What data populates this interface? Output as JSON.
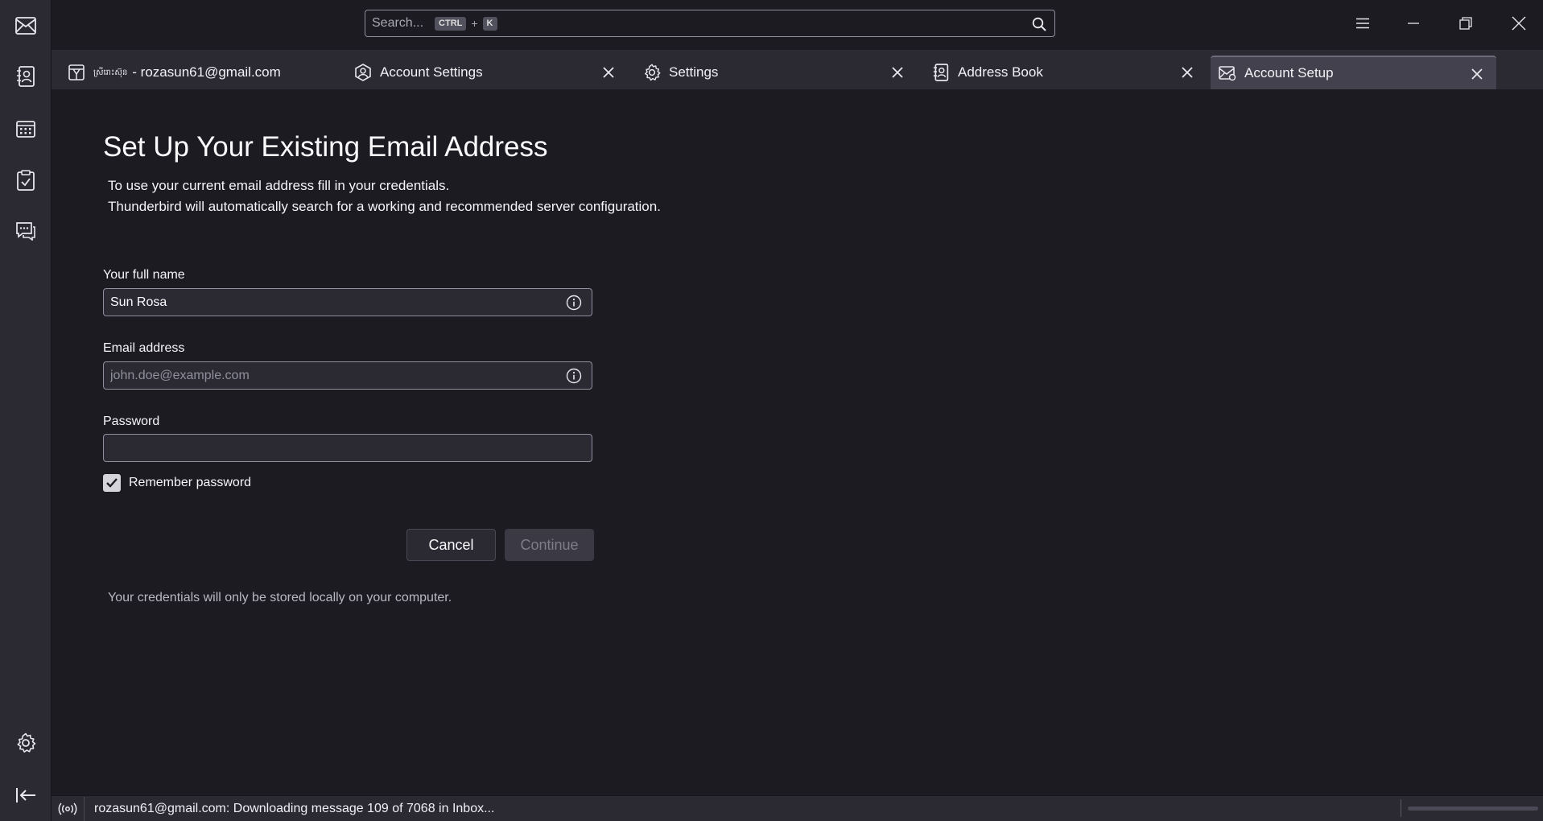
{
  "search": {
    "placeholder": "Search...",
    "shortcut_key1": "CTRL",
    "shortcut_plus": "+",
    "shortcut_key2": "K"
  },
  "tabs": [
    {
      "label": "- rozasun61@gmail.com",
      "prefix": "ស្រីរោះស៊ុន",
      "icon": "inbox-icon",
      "closable": false
    },
    {
      "label": "Account Settings",
      "icon": "account-settings-icon",
      "closable": true
    },
    {
      "label": "Settings",
      "icon": "gear-icon",
      "closable": true
    },
    {
      "label": "Address Book",
      "icon": "address-book-icon",
      "closable": true
    },
    {
      "label": "Account Setup",
      "icon": "account-setup-icon",
      "closable": true,
      "active": true
    }
  ],
  "spaces": [
    "mail-icon",
    "address-book-icon",
    "calendar-icon",
    "tasks-icon",
    "chat-icon",
    "settings-icon",
    "collapse-icon"
  ],
  "main": {
    "title": "Set Up Your Existing Email Address",
    "intro_line1": "To use your current email address fill in your credentials.",
    "intro_line2": "Thunderbird will automatically search for a working and recommended server configuration.",
    "name_label": "Your full name",
    "name_value": "Sun Rosa",
    "email_label": "Email address",
    "email_placeholder": "john.doe@example.com",
    "email_value": "",
    "password_label": "Password",
    "password_value": "",
    "remember_label": "Remember password",
    "remember_checked": true,
    "cancel_label": "Cancel",
    "continue_label": "Continue",
    "continue_enabled": false,
    "footnote": "Your credentials will only be stored locally on your computer."
  },
  "status": {
    "text": "rozasun61@gmail.com: Downloading message 109 of 7068 in Inbox..."
  },
  "colors": {
    "background": "#1c1b22",
    "toolbar": "#2b2a33",
    "active_tab": "#42414d"
  }
}
